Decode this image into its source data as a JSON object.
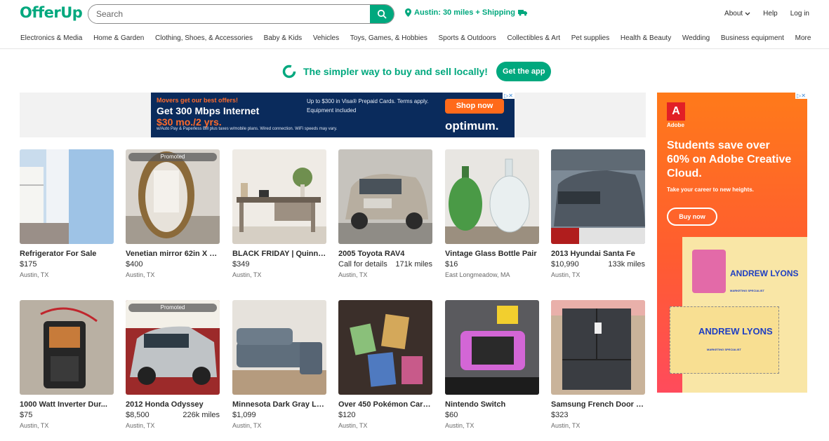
{
  "header": {
    "logo": "OfferUp",
    "search_placeholder": "Search",
    "location": "Austin: 30 miles + Shipping",
    "nav": [
      "About",
      "Help",
      "Log in"
    ]
  },
  "categories": [
    "Electronics & Media",
    "Home & Garden",
    "Clothing, Shoes, & Accessories",
    "Baby & Kids",
    "Vehicles",
    "Toys, Games, & Hobbies",
    "Sports & Outdoors",
    "Collectibles & Art",
    "Pet supplies",
    "Health & Beauty",
    "Wedding",
    "Business equipment",
    "More"
  ],
  "promo": {
    "text": "The simpler way to buy and sell locally!",
    "button": "Get the app"
  },
  "top_ad": {
    "line1": "Movers get our best offers!",
    "line2": "Get 300 Mbps Internet",
    "line3": "$30 mo./2 yrs.",
    "fine": "w/Auto Pay & Paperless Bill plus taxes w/mobile plans. Wired connection. WiFi speeds may vary.",
    "bullet1": "Up to $300 in Visa® Prepaid Cards. Terms apply.",
    "bullet2": "Equipment included",
    "cta": "Shop now",
    "brand": "optimum."
  },
  "listings": [
    {
      "title": "Refrigerator For Sale",
      "price": "$175",
      "extra": "",
      "location": "Austin, TX",
      "promoted": false
    },
    {
      "title": "Venetian mirror 62in X 3...",
      "price": "$400",
      "extra": "",
      "location": "Austin, TX",
      "promoted": true
    },
    {
      "title": "BLACK FRIDAY | Quinn ...",
      "price": "$349",
      "extra": "",
      "location": "Austin, TX",
      "promoted": false
    },
    {
      "title": "2005 Toyota RAV4",
      "price": "Call for details",
      "extra": "171k miles",
      "location": "Austin, TX",
      "promoted": false
    },
    {
      "title": "Vintage Glass Bottle Pair",
      "price": "$16",
      "extra": "",
      "location": "East Longmeadow, MA",
      "promoted": false
    },
    {
      "title": "2013 Hyundai Santa Fe",
      "price": "$10,990",
      "extra": "133k miles",
      "location": "Austin, TX",
      "promoted": false
    },
    {
      "title": "1000 Watt Inverter Dur...",
      "price": "$75",
      "extra": "",
      "location": "Austin, TX",
      "promoted": false
    },
    {
      "title": "2012 Honda Odyssey",
      "price": "$8,500",
      "extra": "226k miles",
      "location": "Austin, TX",
      "promoted": true
    },
    {
      "title": "Minnesota Dark Gray LA...",
      "price": "$1,099",
      "extra": "",
      "location": "Austin, TX",
      "promoted": false
    },
    {
      "title": "Over 450 Pokémon Card...",
      "price": "$120",
      "extra": "",
      "location": "Austin, TX",
      "promoted": false
    },
    {
      "title": "Nintendo Switch",
      "price": "$60",
      "extra": "",
      "location": "Austin, TX",
      "promoted": false
    },
    {
      "title": "Samsung French Door R...",
      "price": "$323",
      "extra": "",
      "location": "Austin, TX",
      "promoted": false
    }
  ],
  "promoted_label": "Promoted",
  "side_ad": {
    "brand": "Adobe",
    "headline": "Students save over 60% on Adobe Creative Cloud.",
    "sub": "Take your career to new heights.",
    "cta": "Buy now",
    "resume_name": "ANDREW LYONS",
    "resume_title": "MARKETING SPECIALIST"
  },
  "colors": {
    "brand": "#00a87e",
    "ad_orange": "#ff6a1a",
    "ad_navy": "#0a2b5c"
  }
}
